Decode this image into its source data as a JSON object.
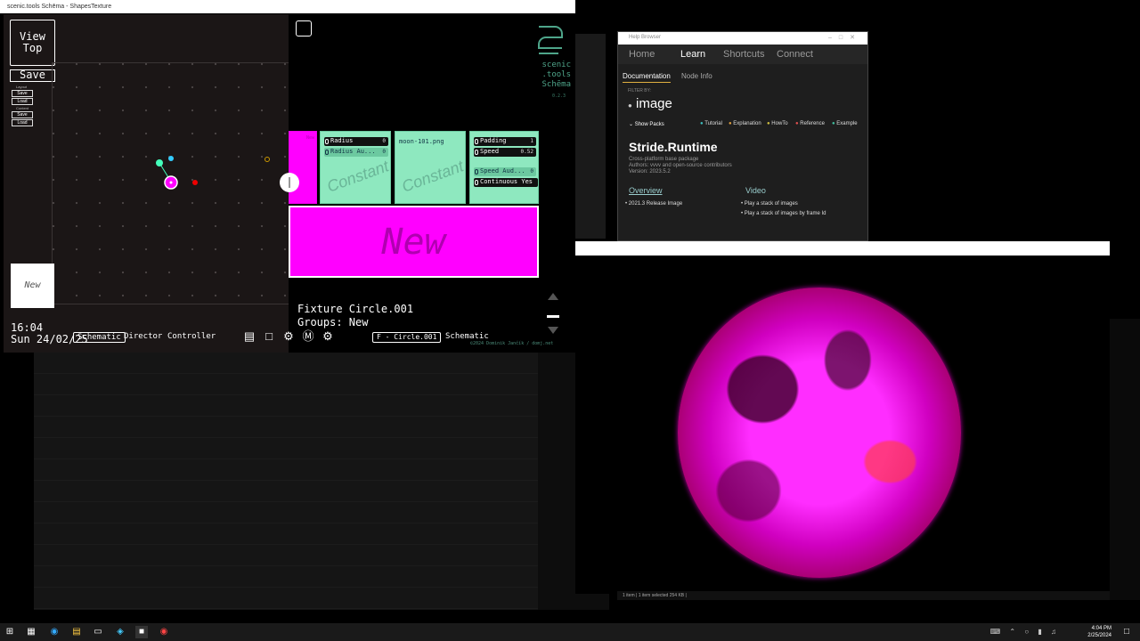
{
  "scenic": {
    "title": "scenic.tools Schēma - ShapesTexture",
    "view_top": "View\nTop",
    "save": "Save",
    "layout_label": "Layout",
    "content_label": "Content",
    "layout_save": "Save",
    "layout_load": "Load",
    "content_save": "Save",
    "content_load": "Load",
    "new_tile": "New",
    "time": "16:04",
    "date": "Sun 24/02/25",
    "tabs": [
      "Schematic",
      "Director",
      "Controller"
    ],
    "logo": "scenic\n.tools\nSchēma",
    "version": "0.2.3",
    "cards": {
      "radius_label": "Radius",
      "radius_val": "0",
      "radius_aud": "Radius Au...",
      "radius_aud_val": "0",
      "image_file": "moon-101.png",
      "padding_label": "Padding",
      "padding_val": "1",
      "speed_label": "Speed",
      "speed_val": "0.52",
      "speed_aud": "Speed Aud...",
      "speed_aud_val": "0",
      "continuous": "Continuous Yes",
      "constant": "Constant",
      "new_small": "New"
    },
    "new_big": "New",
    "fixture_name": "Fixture Circle.001",
    "fixture_groups": "Groups: New",
    "fixture_chip": "F - Circle.001",
    "schematic_label": "Schematic",
    "copyright": "©2024 Dominik Jančík / domj.net"
  },
  "help": {
    "title": "Help Browser",
    "nav": [
      "Home",
      "Learn",
      "Shortcuts",
      "Connect"
    ],
    "sub": [
      "Documentation",
      "Node Info"
    ],
    "filter_by": "FILTER BY:",
    "filter_term": "image",
    "show_packs": "Show Packs",
    "tags": [
      "Tutorial",
      "Explanation",
      "HowTo",
      "Reference",
      "Example"
    ],
    "tag_colors": [
      "#3fc0c0",
      "#e0a040",
      "#d0c040",
      "#e05050",
      "#40c0a0"
    ],
    "package": "Stride.Runtime",
    "meta": [
      "Cross-platform base package",
      "Authors: vvvv and open-source contributors",
      "Version: 2023.5.2"
    ],
    "overview": "Overview",
    "video": "Video",
    "overview_link": "2021.3 Release Image",
    "video_links": [
      "Play a stack of images",
      "Play a stack of images by frame Id"
    ]
  },
  "status": "1 item   |   1 item selected   254 KB   |",
  "taskbar": {
    "time": "4:04 PM",
    "date": "2/25/2024"
  }
}
